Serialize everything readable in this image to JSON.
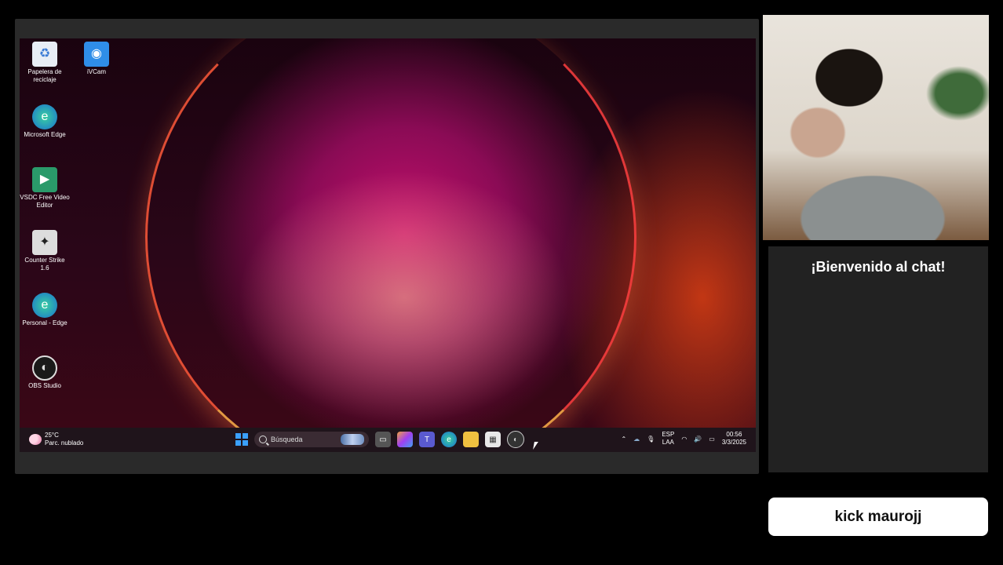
{
  "desktop": {
    "icons": [
      {
        "label": "Papelera de reciclaje",
        "icon": "recycle-bin-icon"
      },
      {
        "label": "iVCam",
        "icon": "ivcam-icon"
      },
      {
        "label": "Microsoft Edge",
        "icon": "edge-icon"
      },
      {
        "label": "VSDC Free Video Editor",
        "icon": "vsdc-icon"
      },
      {
        "label": "Counter Strike 1.6",
        "icon": "counter-strike-icon"
      },
      {
        "label": "Personal - Edge",
        "icon": "edge-profile-icon"
      },
      {
        "label": "OBS Studio",
        "icon": "obs-icon"
      }
    ]
  },
  "taskbar": {
    "weather_temp": "25°C",
    "weather_desc": "Parc. nublado",
    "search_placeholder": "Búsqueda",
    "lang_top": "ESP",
    "lang_bottom": "LAA",
    "time": "00:56",
    "date": "3/3/2025"
  },
  "chat": {
    "title": "¡Bienvenido al chat!"
  },
  "nametag": {
    "label": "kick maurojj"
  },
  "colors": {
    "start_blue": "#3aa0ff",
    "chat_bg": "#222222"
  }
}
